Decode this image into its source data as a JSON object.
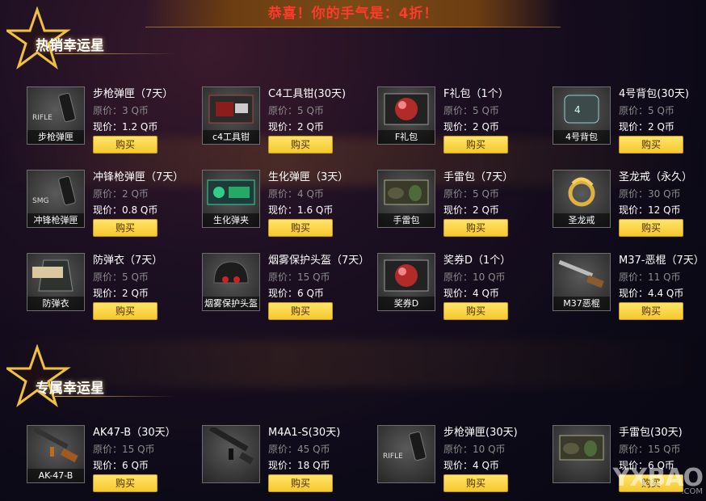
{
  "banner": {
    "text": "恭喜！你的手气是：4折！"
  },
  "sections": [
    {
      "title": "热销幸运星",
      "items": [
        {
          "caption": "步枪弹匣",
          "art": "RIFLE",
          "name": "步枪弹匣（7天）",
          "orig": "原价：3 Q币",
          "now": "现价：1.2 Q币",
          "buy": "购买",
          "icon": "rifle-magazine-icon"
        },
        {
          "caption": "c4工具钳",
          "art": "c4-tool",
          "name": "C4工具钳(30天)",
          "orig": "原价：5 Q币",
          "now": "现价：2 Q币",
          "buy": "购买",
          "icon": "c4-pliers-icon"
        },
        {
          "caption": "F礼包",
          "art": "orb",
          "name": "F礼包（1个）",
          "orig": "原价：5 Q币",
          "now": "现价：2 Q币",
          "buy": "购买",
          "icon": "gift-orb-icon"
        },
        {
          "caption": "4号背包",
          "art": "bag",
          "name": "4号背包(30天)",
          "orig": "原价：5 Q币",
          "now": "现价：2 Q币",
          "buy": "购买",
          "icon": "backpack-icon"
        },
        {
          "caption": "冲锋枪弹匣",
          "art": "SMG",
          "name": "冲锋枪弹匣（7天）",
          "orig": "原价：2 Q币",
          "now": "现价：0.8 Q币",
          "buy": "购买",
          "icon": "smg-magazine-icon"
        },
        {
          "caption": "生化弹夹",
          "art": "bio",
          "name": "生化弹匣（3天）",
          "orig": "原价：4 Q币",
          "now": "现价：1.6 Q币",
          "buy": "购买",
          "icon": "bio-clip-icon"
        },
        {
          "caption": "手雷包",
          "art": "grenade",
          "name": "手雷包（7天）",
          "orig": "原价：5 Q币",
          "now": "现价：2 Q币",
          "buy": "购买",
          "icon": "grenade-pack-icon"
        },
        {
          "caption": "圣龙戒",
          "art": "ring",
          "name": "圣龙戒（永久）",
          "orig": "原价：30 Q币",
          "now": "现价：12 Q币",
          "buy": "购买",
          "icon": "dragon-ring-icon"
        },
        {
          "caption": "防弹衣",
          "art": "vest",
          "name": "防弹衣（7天）",
          "orig": "原价：5 Q币",
          "now": "现价：2 Q币",
          "buy": "购买",
          "icon": "bulletproof-vest-icon"
        },
        {
          "caption": "烟雾保护头盔",
          "art": "helmet",
          "name": "烟雾保护头盔（7天）",
          "orig": "原价：15 Q币",
          "now": "现价：6 Q币",
          "buy": "购买",
          "icon": "helmet-icon"
        },
        {
          "caption": "奖券D",
          "art": "orb",
          "name": "奖券D（1个）",
          "orig": "原价：10 Q币",
          "now": "现价：4 Q币",
          "buy": "购买",
          "icon": "ticket-orb-icon"
        },
        {
          "caption": "M37恶棍",
          "art": "shotgun",
          "name": "M37-恶棍（7天）",
          "orig": "原价：11 Q币",
          "now": "现价：4.4 Q币",
          "buy": "购买",
          "icon": "shotgun-icon"
        }
      ]
    },
    {
      "title": "专属幸运星",
      "items": [
        {
          "caption": "AK-47-B",
          "art": "rifle",
          "name": "AK47-B（30天）",
          "orig": "原价：15 Q币",
          "now": "现价：6 Q币",
          "buy": "购买",
          "icon": "ak47-icon"
        },
        {
          "caption": "",
          "art": "m4",
          "name": "M4A1-S(30天)",
          "orig": "原价：45 Q币",
          "now": "现价：18 Q币",
          "buy": "购买",
          "icon": "m4a1-icon"
        },
        {
          "caption": "",
          "art": "RIFLE",
          "name": "步枪弹匣(30天)",
          "orig": "原价：10 Q币",
          "now": "现价：4 Q币",
          "buy": "购买",
          "icon": "rifle-magazine-icon"
        },
        {
          "caption": "",
          "art": "grenade",
          "name": "手雷包(30天)",
          "orig": "原价：15 Q币",
          "now": "现价：6 Q币",
          "buy": "购买",
          "icon": "grenade-pack-icon"
        }
      ]
    }
  ],
  "watermark": {
    "main": "YXBAO",
    "sub": ".COM"
  },
  "colors": {
    "banner_text": "#ff3a2c",
    "button": "#f5c92c",
    "star": "#f0c040"
  }
}
